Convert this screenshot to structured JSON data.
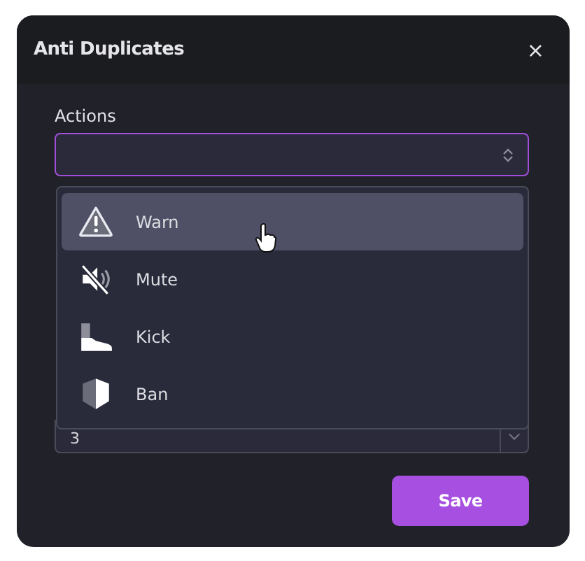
{
  "dialog": {
    "title": "Anti Duplicates",
    "close": "×"
  },
  "actions": {
    "label": "Actions",
    "open": true,
    "options": [
      {
        "label": "Warn",
        "selected": true
      },
      {
        "label": "Mute",
        "selected": false
      },
      {
        "label": "Kick",
        "selected": false
      },
      {
        "label": "Ban",
        "selected": false
      }
    ]
  },
  "count": {
    "value": "3"
  },
  "buttons": {
    "save": "Save"
  }
}
